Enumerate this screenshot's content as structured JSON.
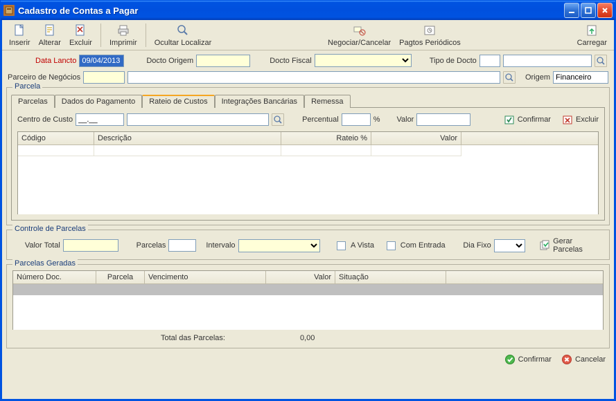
{
  "window": {
    "title": "Cadastro de Contas a Pagar"
  },
  "toolbar": {
    "inserir": "Inserir",
    "alterar": "Alterar",
    "excluir": "Excluir",
    "imprimir": "Imprimir",
    "ocultar": "Ocultar Localizar",
    "negociar": "Negociar/Cancelar",
    "pagtos": "Pagtos Periódicos",
    "carregar": "Carregar"
  },
  "fields": {
    "data_lancto_label": "Data Lancto",
    "data_lancto_value": "09/04/2013",
    "docto_origem_label": "Docto Origem",
    "docto_origem_value": "",
    "docto_fiscal_label": "Docto Fiscal",
    "docto_fiscal_value": "",
    "tipo_docto_label": "Tipo de Docto",
    "tipo_docto_value": "",
    "tipo_docto_desc": "",
    "parceiro_label": "Parceiro de Negócios",
    "parceiro_code": "",
    "parceiro_desc": "",
    "origem_label": "Origem",
    "origem_value": "Financeiro"
  },
  "parcela": {
    "group_label": "Parcela",
    "tabs": {
      "parcelas": "Parcelas",
      "dados": "Dados do Pagamento",
      "rateio": "Rateio de Custos",
      "integracoes": "Integrações Bancárias",
      "remessa": "Remessa"
    },
    "rateio": {
      "centro_custo_label": "Centro de Custo",
      "centro_custo_value": "__.__",
      "centro_custo_desc": "",
      "percentual_label": "Percentual",
      "percentual_value": "",
      "pct_suffix": "%",
      "valor_label": "Valor",
      "valor_value": "",
      "confirmar": "Confirmar",
      "excluir": "Excluir",
      "grid_cols": {
        "codigo": "Código",
        "descricao": "Descrição",
        "rateio": "Rateio %",
        "valor": "Valor"
      }
    }
  },
  "controle": {
    "group_label": "Controle de Parcelas",
    "valor_total_label": "Valor Total",
    "valor_total_value": "",
    "parcelas_label": "Parcelas",
    "parcelas_value": "",
    "intervalo_label": "Intervalo",
    "intervalo_combo": "",
    "avista_label": "A Vista",
    "com_entrada_label": "Com Entrada",
    "dia_fixo_label": "Dia Fixo",
    "dia_fixo_combo": "",
    "gerar_parcelas": "Gerar Parcelas"
  },
  "geradas": {
    "group_label": "Parcelas Geradas",
    "cols": {
      "num": "Número Doc.",
      "parcela": "Parcela",
      "venc": "Vencimento",
      "valor": "Valor",
      "sit": "Situação"
    },
    "total_label": "Total das Parcelas:",
    "total_value": "0,00"
  },
  "footer": {
    "confirmar": "Confirmar",
    "cancelar": "Cancelar"
  }
}
